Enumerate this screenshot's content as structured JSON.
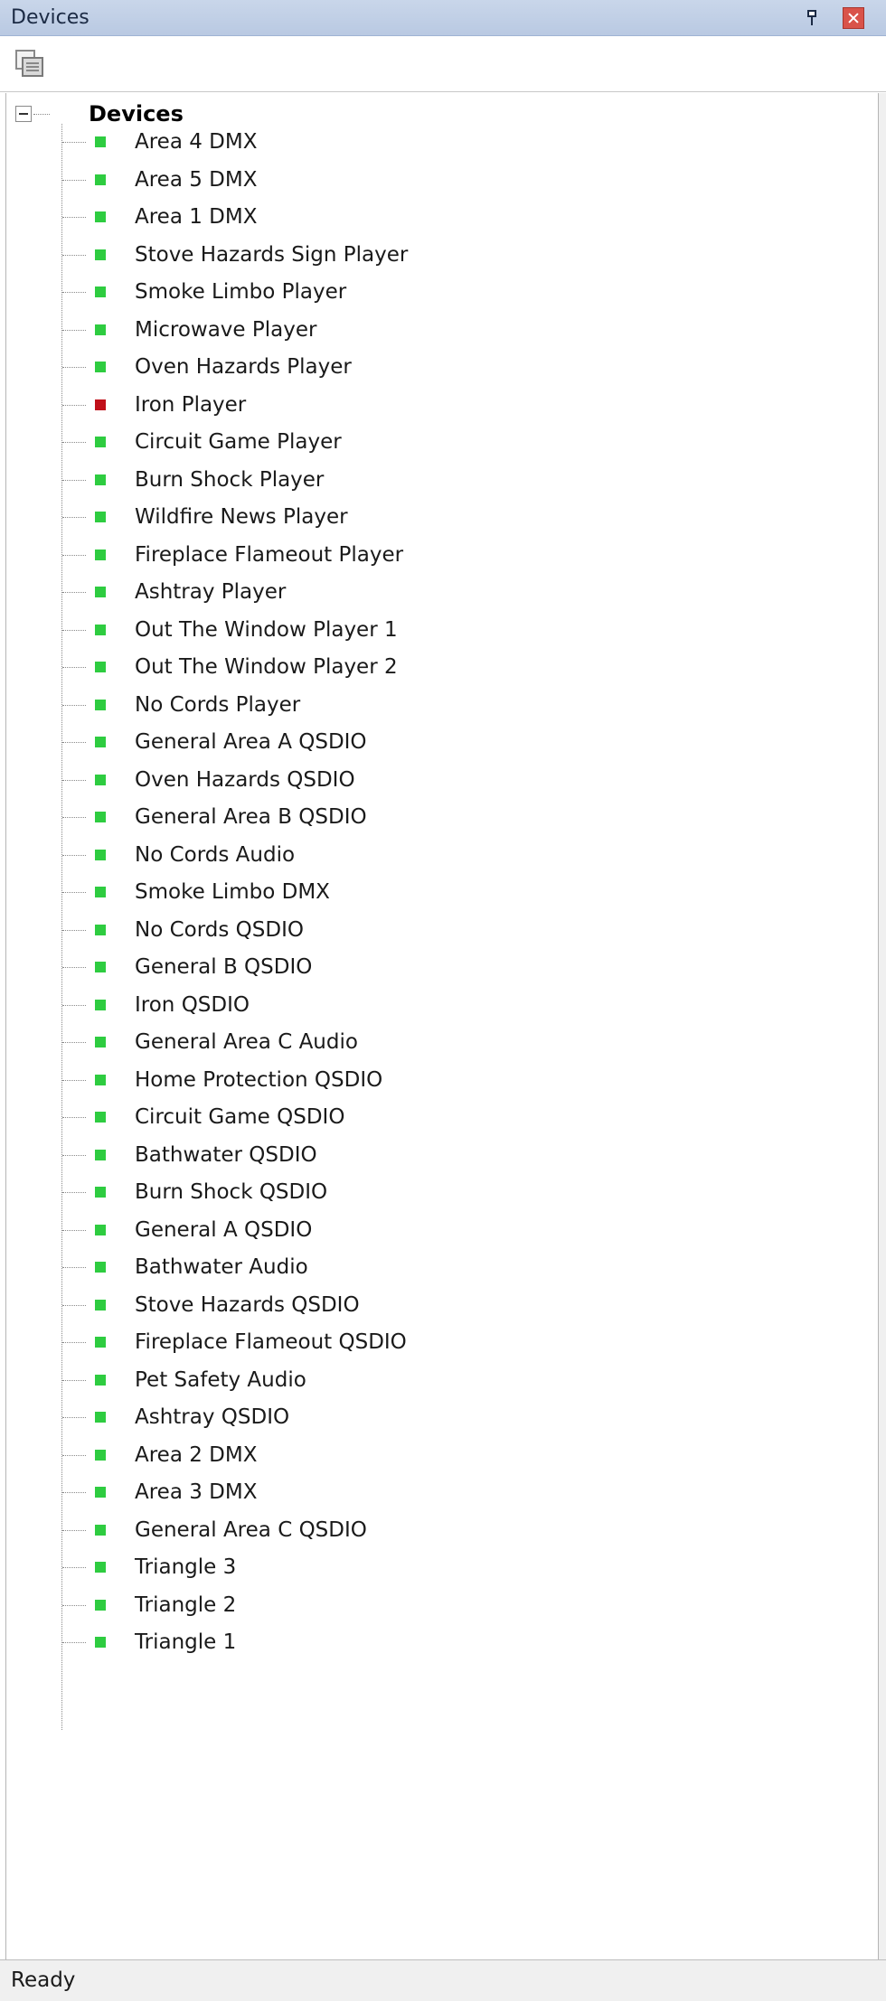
{
  "window": {
    "title": "Devices",
    "pin_icon": "pin-icon",
    "close_icon": "close-icon"
  },
  "toolbar": {
    "icon": "copy-icon"
  },
  "tree": {
    "root_label": "Devices",
    "colors": {
      "ok": "#2ecc40",
      "error": "#c0101a"
    },
    "items": [
      {
        "label": "Area 4 DMX",
        "status": "ok"
      },
      {
        "label": "Area 5 DMX",
        "status": "ok"
      },
      {
        "label": "Area 1 DMX",
        "status": "ok"
      },
      {
        "label": "Stove Hazards Sign Player",
        "status": "ok"
      },
      {
        "label": "Smoke Limbo Player",
        "status": "ok"
      },
      {
        "label": "Microwave Player",
        "status": "ok"
      },
      {
        "label": "Oven Hazards Player",
        "status": "ok"
      },
      {
        "label": "Iron Player",
        "status": "error"
      },
      {
        "label": "Circuit Game Player",
        "status": "ok"
      },
      {
        "label": "Burn Shock Player",
        "status": "ok"
      },
      {
        "label": "Wildfire News Player",
        "status": "ok"
      },
      {
        "label": "Fireplace Flameout Player",
        "status": "ok"
      },
      {
        "label": "Ashtray Player",
        "status": "ok"
      },
      {
        "label": "Out The Window Player 1",
        "status": "ok"
      },
      {
        "label": "Out The Window Player 2",
        "status": "ok"
      },
      {
        "label": "No Cords Player",
        "status": "ok"
      },
      {
        "label": "General Area A QSDIO",
        "status": "ok"
      },
      {
        "label": "Oven Hazards QSDIO",
        "status": "ok"
      },
      {
        "label": "General Area B QSDIO",
        "status": "ok"
      },
      {
        "label": "No Cords Audio",
        "status": "ok"
      },
      {
        "label": "Smoke Limbo DMX",
        "status": "ok"
      },
      {
        "label": "No Cords QSDIO",
        "status": "ok"
      },
      {
        "label": "General B QSDIO",
        "status": "ok"
      },
      {
        "label": "Iron QSDIO",
        "status": "ok"
      },
      {
        "label": "General Area C Audio",
        "status": "ok"
      },
      {
        "label": "Home Protection QSDIO",
        "status": "ok"
      },
      {
        "label": "Circuit Game QSDIO",
        "status": "ok"
      },
      {
        "label": "Bathwater QSDIO",
        "status": "ok"
      },
      {
        "label": "Burn Shock QSDIO",
        "status": "ok"
      },
      {
        "label": "General A QSDIO",
        "status": "ok"
      },
      {
        "label": "Bathwater Audio",
        "status": "ok"
      },
      {
        "label": "Stove Hazards QSDIO",
        "status": "ok"
      },
      {
        "label": "Fireplace Flameout QSDIO",
        "status": "ok"
      },
      {
        "label": "Pet Safety Audio",
        "status": "ok"
      },
      {
        "label": "Ashtray QSDIO",
        "status": "ok"
      },
      {
        "label": "Area 2 DMX",
        "status": "ok"
      },
      {
        "label": "Area 3 DMX",
        "status": "ok"
      },
      {
        "label": "General Area C QSDIO",
        "status": "ok"
      },
      {
        "label": "Triangle 3",
        "status": "ok"
      },
      {
        "label": "Triangle 2",
        "status": "ok"
      },
      {
        "label": "Triangle 1",
        "status": "ok"
      }
    ]
  },
  "statusbar": {
    "text": "Ready"
  }
}
